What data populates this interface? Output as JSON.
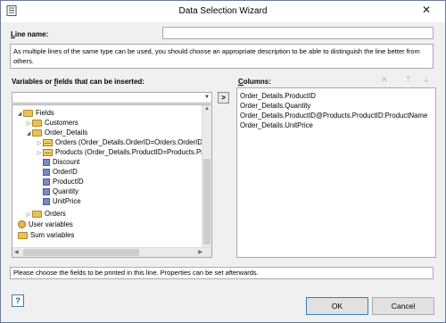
{
  "window": {
    "title": "Data Selection Wizard",
    "close_glyph": "✕",
    "app_icon": "document-icon"
  },
  "line_name": {
    "label_u": "L",
    "label_rest": "ine name:",
    "value": ""
  },
  "description": "As multiple lines of the same type can be used, you should choose an appropriate description to be able to distinguish the line better from others.",
  "fields_panel": {
    "label_pre": "Variables or ",
    "label_u": "f",
    "label_post": "ields that can be inserted:",
    "filter_value": "",
    "tree": [
      {
        "label": "Fields",
        "icon": "folder-icon"
      },
      {
        "label": "Customers",
        "icon": "folder-icon"
      },
      {
        "label": "Order_Details",
        "icon": "folder-icon"
      },
      {
        "label": "Orders (Order_Details.OrderID=Orders.OrderID)",
        "icon": "table-icon"
      },
      {
        "label": "Products (Order_Details.ProductID=Products.ProductID)",
        "icon": "table-icon"
      },
      {
        "label": "Discount",
        "icon": "field-icon"
      },
      {
        "label": "OrderID",
        "icon": "field-icon"
      },
      {
        "label": "ProductID",
        "icon": "field-icon"
      },
      {
        "label": "Quantity",
        "icon": "field-icon"
      },
      {
        "label": "UnitPrice",
        "icon": "field-icon"
      },
      {
        "label": "Orders",
        "icon": "folder-icon"
      },
      {
        "label": "User variables",
        "icon": "user-variables-icon"
      },
      {
        "label": "Sum variables",
        "icon": "sum-variables-icon"
      }
    ]
  },
  "add_button": ">",
  "columns_panel": {
    "label_u": "C",
    "label_rest": "olumns:",
    "items": [
      "Order_Details.ProductID",
      "Order_Details.Quantity",
      "Order_Details.ProductID@Products.ProductID:ProductName",
      "Order_Details.UnitPrice"
    ],
    "tools": {
      "delete": "✕",
      "up": "⇡",
      "down": "⇣"
    }
  },
  "status": "Please choose the fields to be printed in this line. Properties can be set afterwards.",
  "buttons": {
    "help": "?",
    "ok": "OK",
    "cancel": "Cancel"
  }
}
